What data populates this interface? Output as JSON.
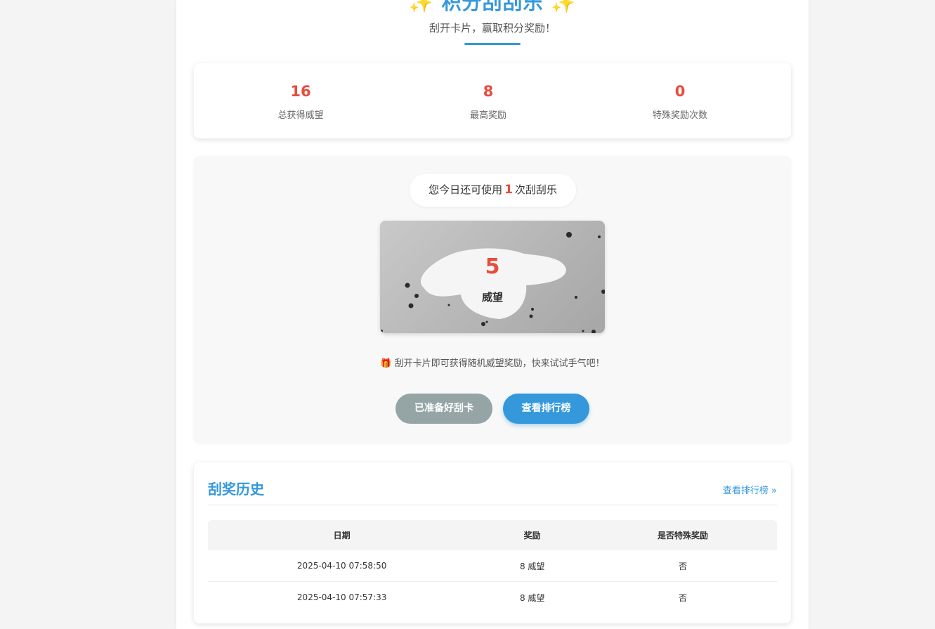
{
  "header": {
    "title": "✨ 积分刮刮乐 ✨",
    "subtitle": "刮开卡片，赢取积分奖励！"
  },
  "stats": [
    {
      "value": "16",
      "label": "总获得威望"
    },
    {
      "value": "8",
      "label": "最高奖励"
    },
    {
      "value": "0",
      "label": "特殊奖励次数"
    }
  ],
  "scratch": {
    "remaining_prefix": "您今日还可使用",
    "remaining_count": "1",
    "remaining_suffix": "次刮刮乐",
    "prize_value": "5",
    "prize_unit": "威望",
    "hint_icon": "gift-icon",
    "hint_text": "刮开卡片即可获得随机威望奖励，快来试试手气吧！",
    "ready_button": "已准备好刮卡",
    "rank_button": "查看排行榜"
  },
  "history": {
    "title": "刮奖历史",
    "link": "查看排行榜 »",
    "columns": [
      "日期",
      "奖励",
      "是否特殊奖励"
    ],
    "rows": [
      [
        "2025-04-10 07:58:50",
        "8 威望",
        "否"
      ],
      [
        "2025-04-10 07:57:33",
        "8 威望",
        "否"
      ]
    ]
  },
  "colors": {
    "accent": "#3498db",
    "highlight": "#e74c3c",
    "muted_button": "#95a5a6"
  }
}
